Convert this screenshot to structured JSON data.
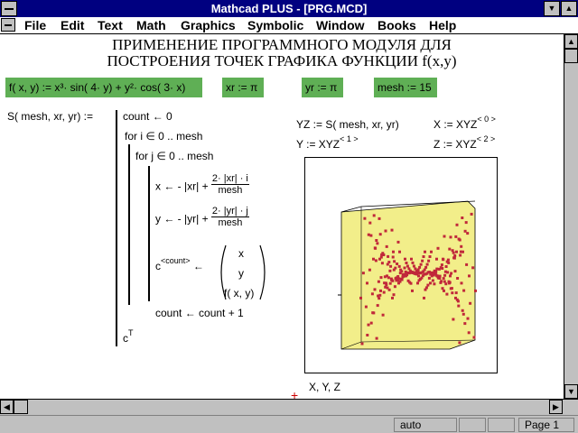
{
  "window": {
    "title": "Mathcad PLUS - [PRG.MCD]"
  },
  "menu": [
    "File",
    "Edit",
    "Text",
    "Math",
    "Graphics",
    "Symbolic",
    "Window",
    "Books",
    "Help"
  ],
  "doc": {
    "title_line1": "ПРИМЕНЕНИЕ ПРОГРАММНОГО МОДУЛЯ ДЛЯ",
    "title_line2": "ПОСТРОЕНИЯ ТОЧЕК ГРАФИКА ФУНКЦИИ f(x,y)",
    "defs": {
      "f_def": "f( x, y) := x³· sin( 4· y) + y²· cos( 3· x)",
      "xr": "xr := π",
      "yr": "yr := π",
      "mesh": "mesh := 15"
    },
    "program": {
      "header": "S( mesh, xr, yr) :=",
      "count_init": "count ← 0",
      "for_i": "for   i ∈ 0 .. mesh",
      "for_j": "for   j ∈ 0 .. mesh",
      "x_left": "x ← - |xr| +",
      "x_num": "2· |xr| · i",
      "x_den": "mesh",
      "y_left": "y ← - |yr| +",
      "y_num": "2· |yr| · j",
      "y_den": "mesh",
      "c_lhs": "c",
      "c_sup": "<count>",
      "c_arrow": "←",
      "vec_x": "x",
      "vec_y": "y",
      "vec_f": "f( x, y)",
      "count_inc": "count ← count + 1",
      "result": "c",
      "result_sup": "T"
    },
    "right": {
      "yz": "YZ := S( mesh, xr, yr)",
      "xdef": "X := XYZ",
      "xsup": "< 0 >",
      "ydef": "Y := XYZ",
      "ysup": "< 1 >",
      "zdef": "Z := XYZ",
      "zsup": "< 2 >",
      "plot_label": "X, Y, Z"
    }
  },
  "status": {
    "mode": "auto",
    "page": "Page 1"
  },
  "colors": {
    "green": "#5faf55",
    "box": "#f2ee8a",
    "point": "#c0283a",
    "titlebar": "#000080"
  },
  "chart_data": {
    "type": "scatter",
    "series": [
      {
        "values_note_points": 256
      }
    ]
  }
}
